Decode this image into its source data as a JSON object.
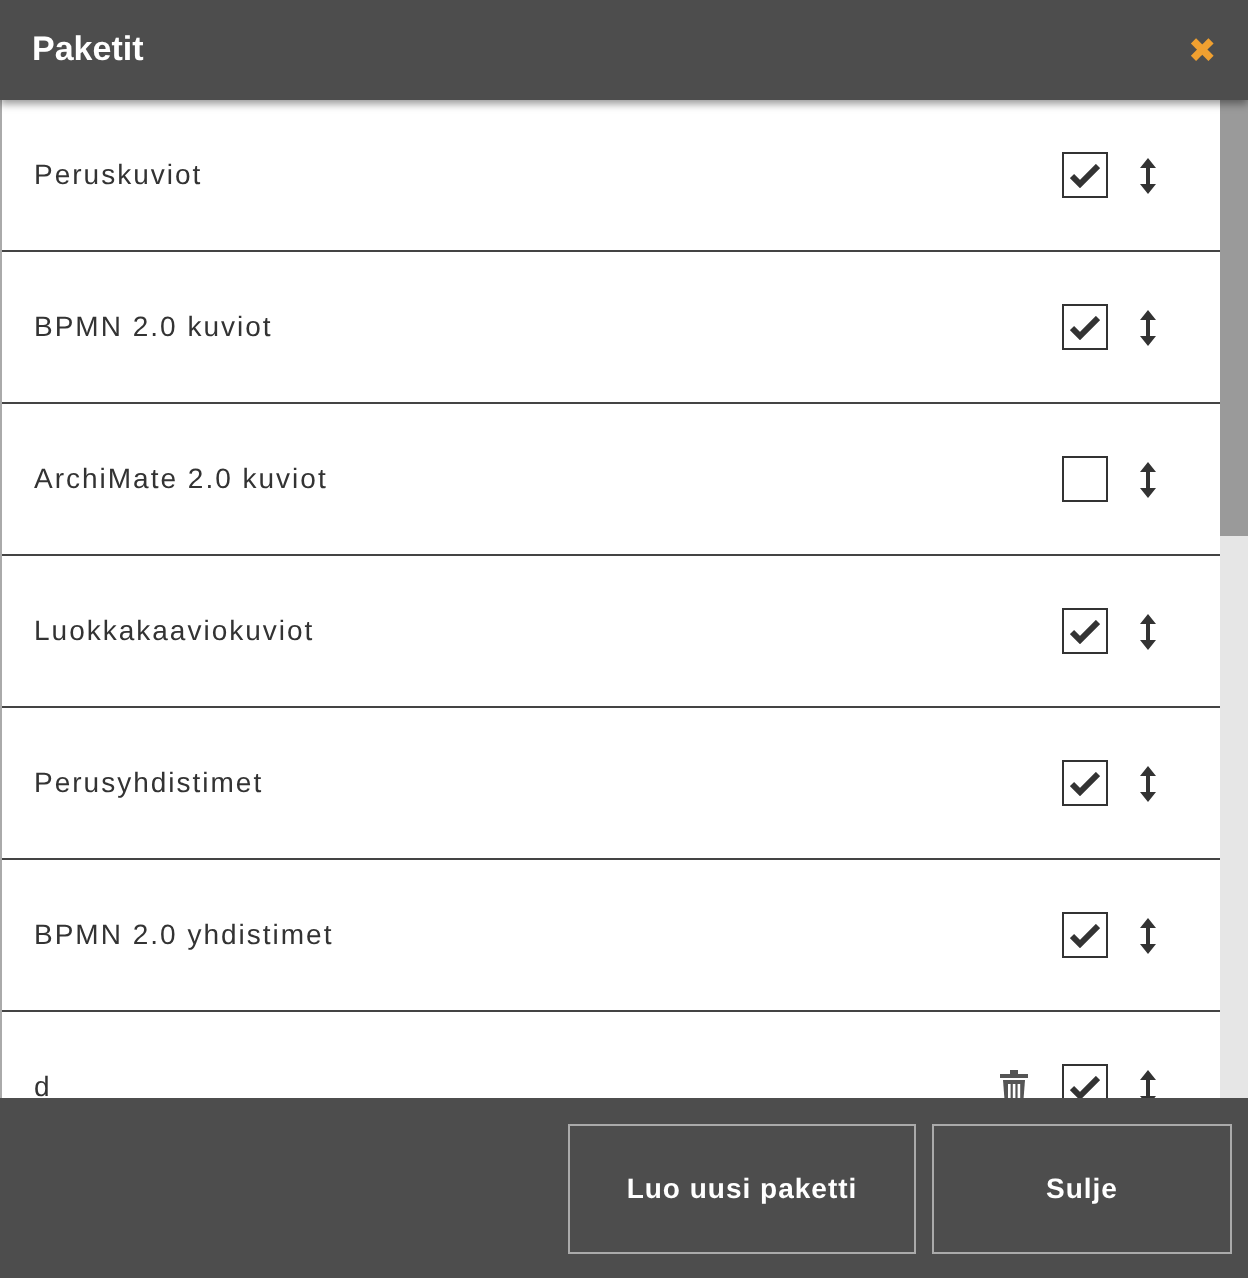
{
  "dialog": {
    "title": "Paketit",
    "close": "✖"
  },
  "packages": [
    {
      "name": "Peruskuviot",
      "checked": true,
      "deletable": false
    },
    {
      "name": "BPMN 2.0 kuviot",
      "checked": true,
      "deletable": false
    },
    {
      "name": "ArchiMate 2.0 kuviot",
      "checked": false,
      "deletable": false
    },
    {
      "name": "Luokkakaaviokuviot",
      "checked": true,
      "deletable": false
    },
    {
      "name": "Perusyhdistimet",
      "checked": true,
      "deletable": false
    },
    {
      "name": "BPMN 2.0 yhdistimet",
      "checked": true,
      "deletable": false
    },
    {
      "name": "d",
      "checked": true,
      "deletable": true
    }
  ],
  "buttons": [
    "Luo uusi paketti",
    "Sulje"
  ]
}
